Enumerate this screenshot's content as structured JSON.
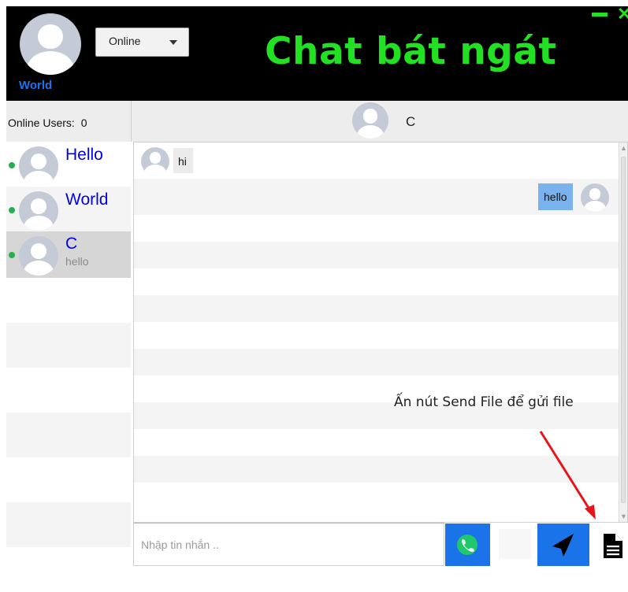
{
  "header": {
    "app_title": "Chat bát ngát",
    "current_user": "World",
    "status_value": "Online",
    "minimize_icon": "minimize-icon",
    "close_icon": "close-icon",
    "accent_color": "#22e022"
  },
  "sidebar": {
    "online_users_label": "Online Users:",
    "online_users_count": "0",
    "users": [
      {
        "name": "Hello",
        "last_message": "",
        "online": true
      },
      {
        "name": "World",
        "last_message": "",
        "online": true
      },
      {
        "name": "C",
        "last_message": "hello",
        "online": true
      }
    ]
  },
  "chat": {
    "contact_name": "C",
    "messages": [
      {
        "direction": "in",
        "text": "hi"
      },
      {
        "direction": "out",
        "text": "hello"
      }
    ]
  },
  "annotation": {
    "text": "Ấn nút Send File để gửi file",
    "arrow_color": "#e8141c"
  },
  "composer": {
    "placeholder": "Nhập tin nhắn ..",
    "call_icon": "phone-icon",
    "send_icon": "paper-plane-icon",
    "file_icon": "document-icon",
    "button_color": "#1a73e8"
  }
}
